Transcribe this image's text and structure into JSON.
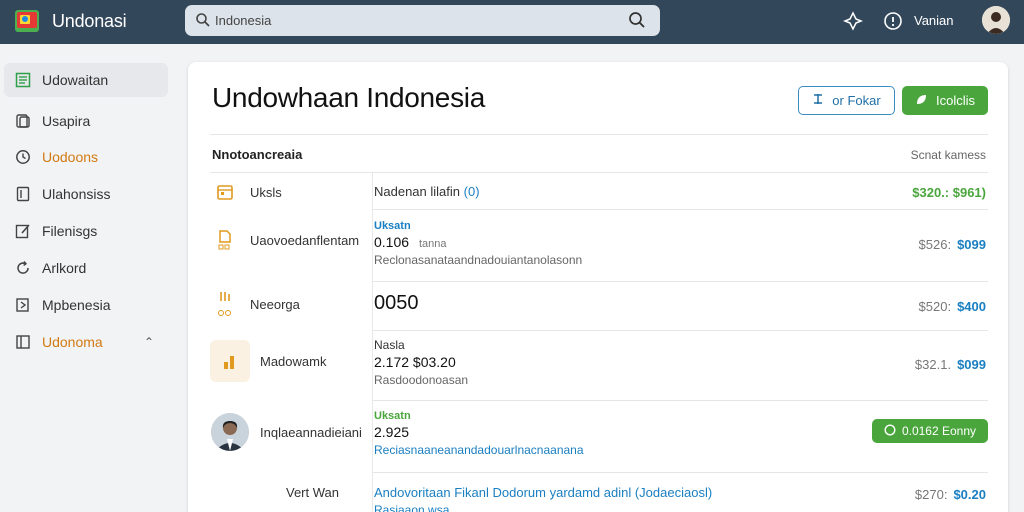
{
  "app": {
    "title": "Undonasi"
  },
  "search": {
    "value": "Indonesia"
  },
  "topbar": {
    "user_name": "Vanian"
  },
  "sidebar": {
    "items": [
      {
        "label": "Udowaitan",
        "icon": "list-icon"
      },
      {
        "label": "Usapira",
        "icon": "tag-icon"
      },
      {
        "label": "Uodoons",
        "icon": "clock-icon"
      },
      {
        "label": "Ulahonsiss",
        "icon": "document-icon"
      },
      {
        "label": "Filenisgs",
        "icon": "edit-icon"
      },
      {
        "label": "Arlkord",
        "icon": "refresh-icon"
      },
      {
        "label": "Mpbenesia",
        "icon": "folder-icon"
      },
      {
        "label": "Udonoma",
        "icon": "plus-box-icon"
      }
    ]
  },
  "main": {
    "title": "Undowhaan Indonesia",
    "btn_outline": "or Fokar",
    "btn_green": "Icolclis",
    "section_title": "Nnotoancreaia",
    "section_right": "Scnat kamess",
    "rows": [
      {
        "name": "Uksls",
        "main": "Nadenan lilafin",
        "main_suffix": "(0)",
        "price": "$320.: $961)"
      },
      {
        "name": "Uaovoedanflentam",
        "tag": "Uksatn",
        "main": "0.106",
        "main_note": "tanna",
        "sub": "Reclonasanataandnadouiantanolasonn",
        "price_old": "$526:",
        "price_new": "$099"
      },
      {
        "name": "Neeorga",
        "main": "0050",
        "price_old": "$520:",
        "price_new": "$400"
      },
      {
        "name": "Madowamk",
        "tag": "Nasla",
        "main": "2.172 $03.20",
        "sub": "Rasdoodonoasan",
        "price_old": "$32.1.",
        "price_new": "$099"
      },
      {
        "name": "Inqlaeannadieiani",
        "tag": "Uksatn",
        "main": "2.925",
        "sub": "Reciasnaaneanandadouarlnacnaanana",
        "badge": "0.0162 Eonny"
      },
      {
        "name": "Vert Wan",
        "main": "Andovoritaan Fikanl Dodorum yardamd adinl (Jodaeciaosl)",
        "sub": "Rasiaaon wsa",
        "price_old": "$270:",
        "price_new": "$0.20"
      }
    ]
  }
}
